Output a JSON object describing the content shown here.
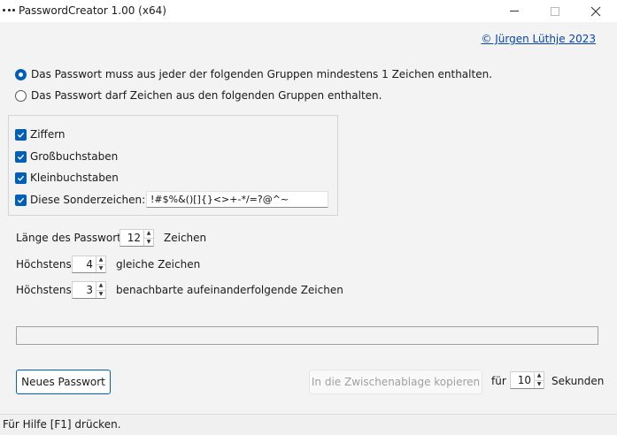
{
  "window": {
    "title": "PasswordCreator 1.00 (x64)"
  },
  "copyright_link": "© Jürgen Lüthje 2023",
  "mode": {
    "options": [
      {
        "label": "Das Passwort muss aus jeder der folgenden Gruppen mindestens 1 Zeichen enthalten.",
        "selected": true
      },
      {
        "label": "Das Passwort darf Zeichen aus den folgenden Gruppen enthalten.",
        "selected": false
      }
    ]
  },
  "groups": {
    "digits": {
      "label": "Ziffern",
      "checked": true
    },
    "uppercase": {
      "label": "Großbuchstaben",
      "checked": true
    },
    "lowercase": {
      "label": "Kleinbuchstaben",
      "checked": true
    },
    "special": {
      "label": "Diese Sonderzeichen:",
      "checked": true,
      "value": "!#$%&()[]{}<>+-*/=?@^~"
    }
  },
  "length": {
    "label": "Länge des Passworts:",
    "value": "12",
    "suffix": "Zeichen"
  },
  "max_same": {
    "label": "Höchstens",
    "value": "4",
    "suffix": "gleiche Zeichen"
  },
  "max_consecutive": {
    "label": "Höchstens",
    "value": "3",
    "suffix": "benachbarte aufeinanderfolgende Zeichen"
  },
  "output": {
    "value": ""
  },
  "buttons": {
    "new_password": "Neues Passwort",
    "copy_clipboard": "In die Zwischenablage kopieren"
  },
  "clipboard_timer": {
    "prefix": "für",
    "value": "10",
    "suffix": "Sekunden"
  },
  "status": "Für Hilfe [F1] drücken.",
  "colors": {
    "accent": "#005fb8",
    "link": "#0645ad",
    "disabled_text": "#a0a0a0"
  }
}
